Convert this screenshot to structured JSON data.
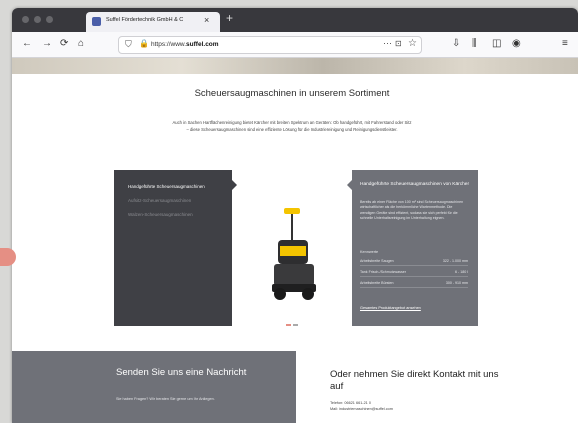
{
  "browser": {
    "tab_title": "Suffel Fördertechnik GmbH & C",
    "tab_close": "×",
    "new_tab": "+",
    "url_prefix": "https://www.",
    "url_domain": "suffel.com",
    "url_suffix": "",
    "url_dots": "···",
    "pocket": "⊡",
    "star": "☆",
    "icons": {
      "back": "←",
      "forward": "→",
      "reload": "⟳",
      "home": "⌂",
      "shield": "⛉",
      "lock": "🔒",
      "download": "⇩",
      "library": "⫼",
      "sidebar": "◫",
      "account": "◉",
      "menu": "≡"
    }
  },
  "section": {
    "heading": "Scheuersaugmaschinen in unserem Sortiment",
    "intro": "Auch in Sachen Hartflächenreinigung bietet Kärcher mit breiten Spektrum an Geräten: Ob handgeführt, mit Fahrerstand oder Sitz – diese Scheuersaugmaschinen sind eine effiziente Lösung für die Industriereinigung und Reinigungsdienstleister."
  },
  "categories": [
    {
      "label": "Handgeführte Scheuersaugmaschinen",
      "active": true
    },
    {
      "label": "Aufsitz-Scheuersaugmaschinen",
      "active": false
    },
    {
      "label": "Walzen-Scheuersaugmaschinen",
      "active": false
    }
  ],
  "product": {
    "title": "Handgeführte Scheuersaugmaschinen von Kärcher",
    "description": "Bereits ab einer Fläche von 100 m² sind Scheuersaugmaschinen wirtschaftlicher als die herkömmliche Wartenmethode. Die wendigen Geräte sind effizient, sodass sie sich perfekt für die schnelle Unterhaltsreinigung im Unterhaltung eignen.",
    "specs_label": "Kennwerte",
    "specs": [
      {
        "key": "Arbeitsbreite Saugen",
        "value": "322 - 1.000 mm"
      },
      {
        "key": "Tank Frisch-/Schmutzwasser",
        "value": "6 - 180 l"
      },
      {
        "key": "Arbeitsbreite Bürsten",
        "value": "300 - 910 mm"
      }
    ],
    "link": "Gesamtes Produktangebot ansehen"
  },
  "carousel": {
    "active_color": "#e58f84",
    "inactive_color": "#aaaaaa"
  },
  "contact": {
    "title": "Senden Sie uns eine Nachricht",
    "text": "Sie haben Fragen? Wir beraten Sie gerne um Ihr Anliegen."
  },
  "direct": {
    "title": "Oder nehmen Sie direkt Kontakt mit uns auf",
    "phone": "Telefon: 06621 661-21 0",
    "mail": "Mail: industriemaschinen@suffel.com"
  },
  "colors": {
    "dark_panel": "#3f4045",
    "gray_panel": "#6f7178",
    "accent": "#e58f84"
  }
}
